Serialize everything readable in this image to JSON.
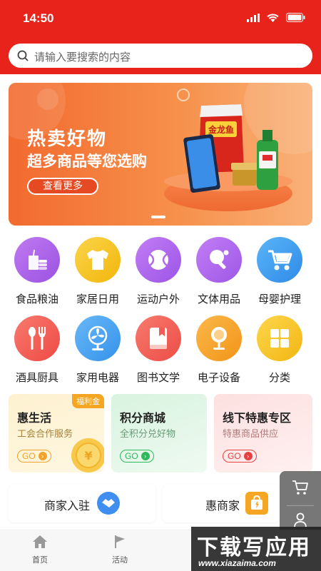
{
  "status_bar": {
    "time": "14:50"
  },
  "search": {
    "placeholder": "请输入要搜索的内容"
  },
  "banner": {
    "title": "热卖好物",
    "subtitle": "超多商品等您选购",
    "button": "查看更多",
    "product_label": "金龙鱼"
  },
  "categories": [
    {
      "label": "食品粮油",
      "icon": "food-icon",
      "color": "#b06ae8"
    },
    {
      "label": "家居日用",
      "icon": "tshirt-icon",
      "color": "#f5c21b"
    },
    {
      "label": "运动户外",
      "icon": "ball-icon",
      "color": "#b86cf0"
    },
    {
      "label": "文体用品",
      "icon": "ping-pong-icon",
      "color": "#b56eec"
    },
    {
      "label": "母婴护理",
      "icon": "stroller-icon",
      "color": "#3f9ff2"
    },
    {
      "label": "酒具厨具",
      "icon": "cutlery-icon",
      "color": "#f25c55"
    },
    {
      "label": "家用电器",
      "icon": "fan-icon",
      "color": "#4aa6f0"
    },
    {
      "label": "图书文学",
      "icon": "book-icon",
      "color": "#f2645c"
    },
    {
      "label": "电子设备",
      "icon": "mirror-icon",
      "color": "#f5a030"
    },
    {
      "label": "分类",
      "icon": "grid-icon",
      "color": "#f5c420"
    }
  ],
  "promos": [
    {
      "title": "惠生活",
      "subtitle": "工会合作服务",
      "go": "GO",
      "tag": "福利金",
      "accent": "#f0a22a"
    },
    {
      "title": "积分商城",
      "subtitle": "全积分兑好物",
      "go": "GO",
      "accent": "#2eb85c"
    },
    {
      "title": "线下特惠专区",
      "subtitle": "特惠商品供应",
      "go": "GO",
      "accent": "#e84040"
    }
  ],
  "merchants": [
    {
      "label": "商家入驻",
      "icon": "handshake-icon"
    },
    {
      "label": "惠商家",
      "icon": "shopping-bag-icon"
    }
  ],
  "tabs": [
    {
      "label": "首页",
      "icon": "home-icon"
    },
    {
      "label": "活动",
      "icon": "flag-icon"
    }
  ],
  "watermark": {
    "main": "下载写应用",
    "url": "www.xiazaima.com"
  }
}
